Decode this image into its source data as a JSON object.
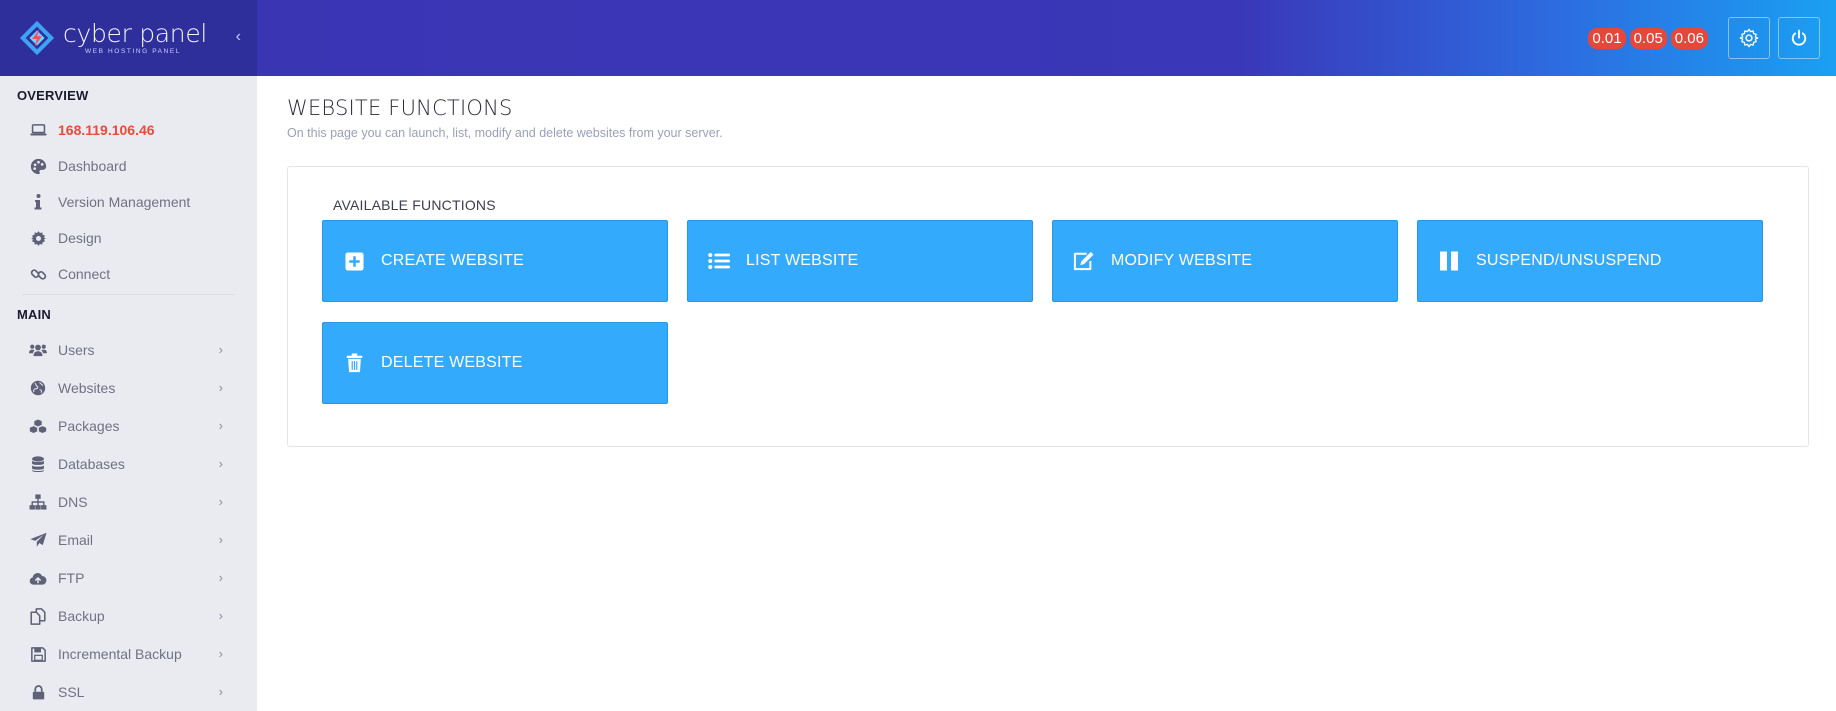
{
  "brand": {
    "name": "cyber panel",
    "subtitle": "WEB HOSTING PANEL"
  },
  "header": {
    "load_averages": [
      "0.01",
      "0.05",
      "0.06"
    ],
    "settings_icon": "gear-icon",
    "power_icon": "power-icon"
  },
  "sidebar": {
    "sections": [
      {
        "title": "OVERVIEW",
        "items": [
          {
            "label": "168.119.106.46",
            "icon": "laptop-icon"
          },
          {
            "label": "Dashboard",
            "icon": "palette-icon"
          },
          {
            "label": "Version Management",
            "icon": "info-icon"
          },
          {
            "label": "Design",
            "icon": "gear-icon"
          },
          {
            "label": "Connect",
            "icon": "link-icon"
          }
        ]
      },
      {
        "title": "MAIN",
        "items": [
          {
            "label": "Users",
            "icon": "users-icon"
          },
          {
            "label": "Websites",
            "icon": "globe-icon"
          },
          {
            "label": "Packages",
            "icon": "cubes-icon"
          },
          {
            "label": "Databases",
            "icon": "database-icon"
          },
          {
            "label": "DNS",
            "icon": "sitemap-icon"
          },
          {
            "label": "Email",
            "icon": "paper-plane-icon"
          },
          {
            "label": "FTP",
            "icon": "cloud-upload-icon"
          },
          {
            "label": "Backup",
            "icon": "copy-icon"
          },
          {
            "label": "Incremental Backup",
            "icon": "save-icon"
          },
          {
            "label": "SSL",
            "icon": "lock-icon"
          }
        ]
      }
    ]
  },
  "main": {
    "title": "WEBSITE FUNCTIONS",
    "description": "On this page you can launch, list, modify and delete websites from your server.",
    "panel_title": "AVAILABLE FUNCTIONS",
    "functions": [
      {
        "label": "CREATE WEBSITE",
        "icon": "plus-square-icon"
      },
      {
        "label": "LIST WEBSITE",
        "icon": "list-icon"
      },
      {
        "label": "MODIFY WEBSITE",
        "icon": "edit-icon"
      },
      {
        "label": "SUSPEND/UNSUSPEND",
        "icon": "pause-icon"
      },
      {
        "label": "DELETE WEBSITE",
        "icon": "trash-icon"
      }
    ]
  },
  "colors": {
    "brand_bg": "#2f2f9c",
    "topbar_start": "#3a35b3",
    "topbar_end": "#1aa0f2",
    "badge": "#e5473b",
    "button": "#33aafb",
    "ip_text": "#e84b3a",
    "sidebar_bg": "#eaebf1"
  }
}
